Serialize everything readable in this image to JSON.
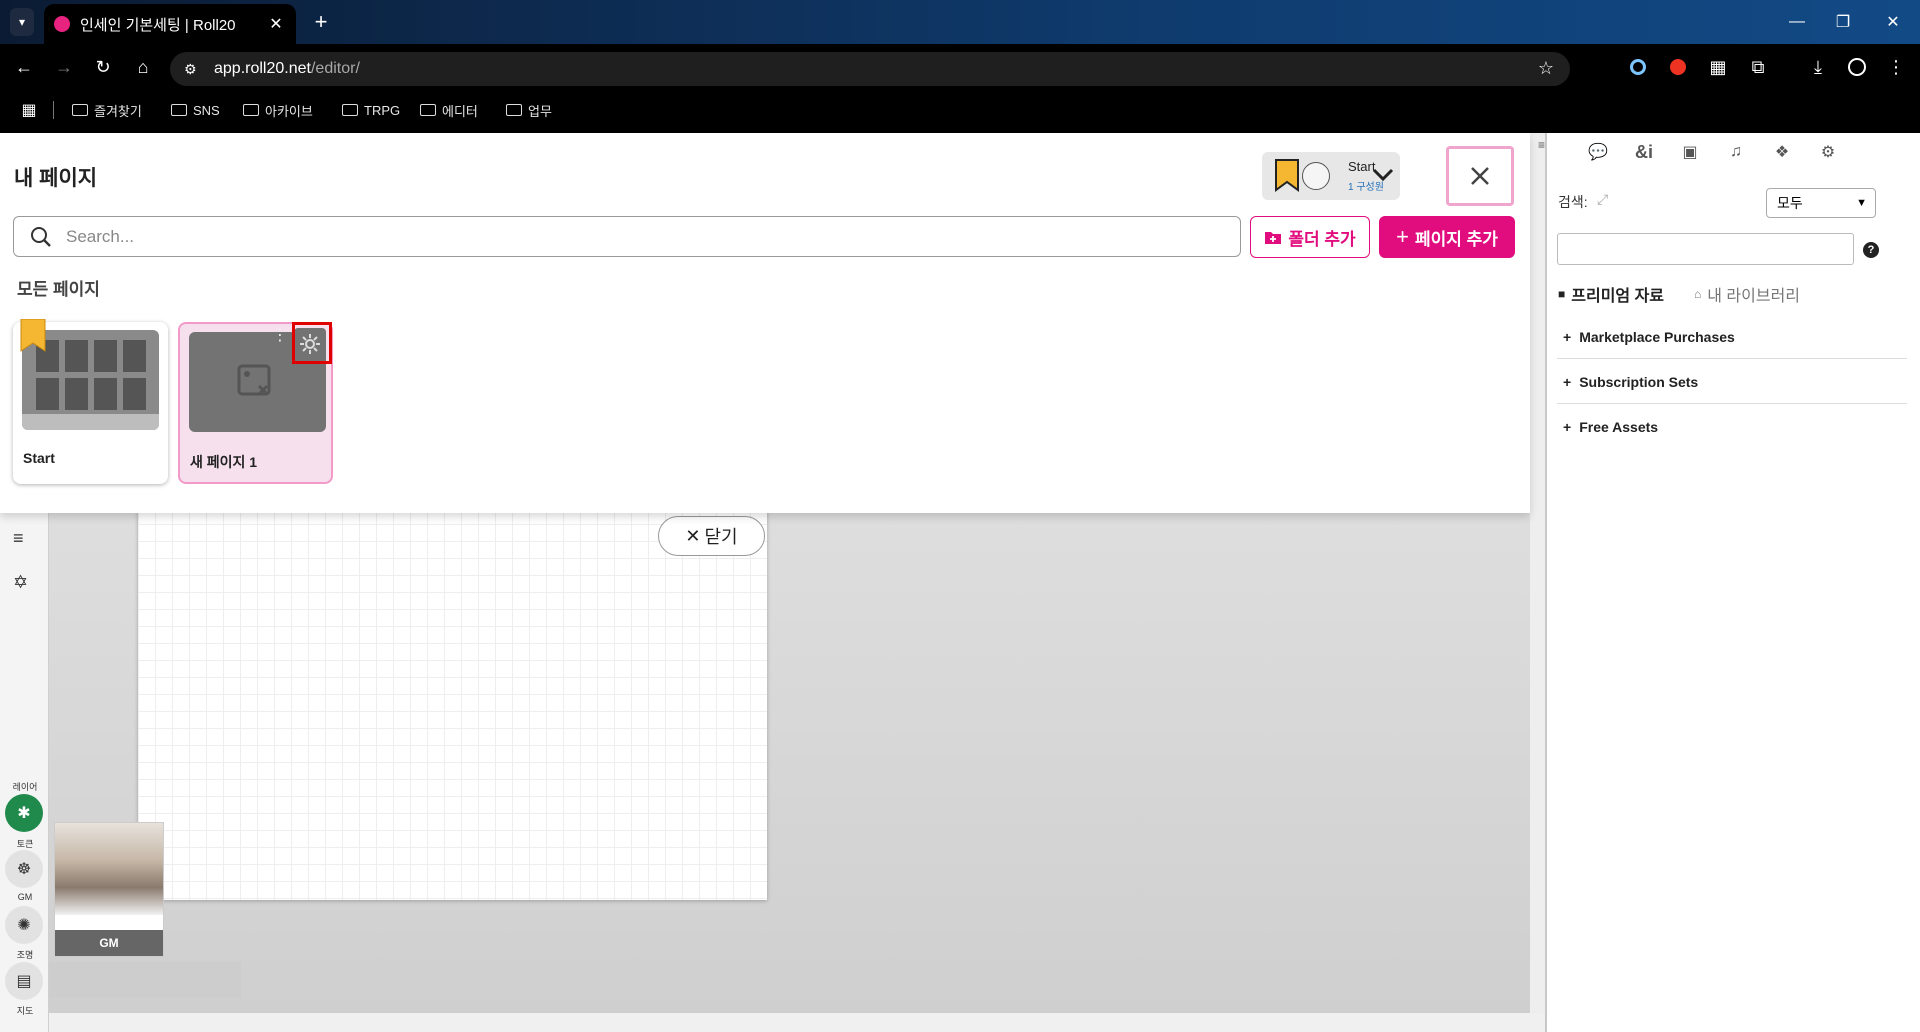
{
  "browser": {
    "tab_title": "인세인 기본세팅 | Roll20",
    "url_host": "app.roll20.net",
    "url_path": "/editor/",
    "bookmarks": [
      "즐겨찾기",
      "SNS",
      "아카이브",
      "TRPG",
      "에디터",
      "업무"
    ]
  },
  "page_manager": {
    "title": "내 페이지",
    "current_page": {
      "name": "Start",
      "members": "1 구성원"
    },
    "search_placeholder": "Search...",
    "add_folder_label": "폴더 추가",
    "add_page_label": "페이지 추가",
    "section_label": "모든 페이지",
    "pages": [
      {
        "name": "Start",
        "bookmarked": true
      },
      {
        "name": "새 페이지 1",
        "bookmarked": false
      }
    ]
  },
  "canvas": {
    "close_label": "닫기",
    "player_label": "GM"
  },
  "left_toolbar": {
    "layer_label": "레이어",
    "layers": [
      "토큰",
      "GM",
      "조명",
      "지도"
    ]
  },
  "right_panel": {
    "search_label": "검색:",
    "filter_value": "모두",
    "tab_premium": "프리미엄 자료",
    "tab_library": "내 라이브러리",
    "sections": [
      "Marketplace Purchases",
      "Subscription Sets",
      "Free Assets"
    ]
  },
  "colors": {
    "accent": "#e10c7d",
    "layer_active": "#1f8a4c"
  }
}
